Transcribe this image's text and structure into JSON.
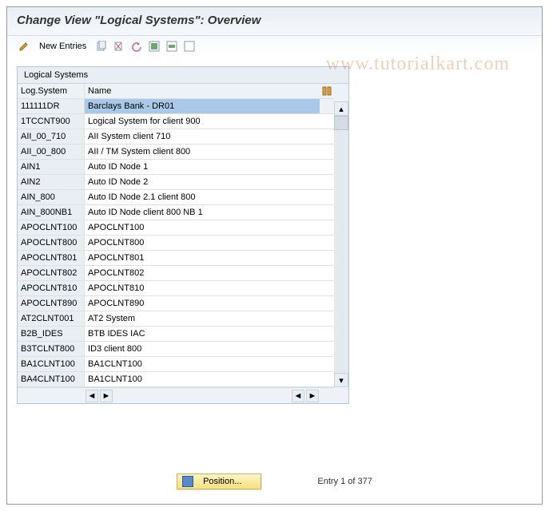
{
  "title": "Change View \"Logical Systems\": Overview",
  "toolbar": {
    "new_entries_label": "New Entries"
  },
  "panel": {
    "title": "Logical Systems",
    "columns": {
      "sys": "Log.System",
      "name": "Name"
    },
    "rows": [
      {
        "sys": "111111DR",
        "name": "Barclays Bank - DR01",
        "selected": true
      },
      {
        "sys": "1TCCNT900",
        "name": "Logical System for client 900"
      },
      {
        "sys": "AII_00_710",
        "name": "AII System client 710"
      },
      {
        "sys": "AII_00_800",
        "name": "AII / TM System client 800"
      },
      {
        "sys": "AIN1",
        "name": "Auto ID Node 1"
      },
      {
        "sys": "AIN2",
        "name": "Auto ID Node 2"
      },
      {
        "sys": "AIN_800",
        "name": "Auto ID Node 2.1 client 800"
      },
      {
        "sys": "AIN_800NB1",
        "name": "Auto ID Node client 800 NB 1"
      },
      {
        "sys": "APOCLNT100",
        "name": "APOCLNT100"
      },
      {
        "sys": "APOCLNT800",
        "name": "APOCLNT800"
      },
      {
        "sys": "APOCLNT801",
        "name": "APOCLNT801"
      },
      {
        "sys": "APOCLNT802",
        "name": "APOCLNT802"
      },
      {
        "sys": "APOCLNT810",
        "name": "APOCLNT810"
      },
      {
        "sys": "APOCLNT890",
        "name": "APOCLNT890"
      },
      {
        "sys": "AT2CLNT001",
        "name": "AT2 System"
      },
      {
        "sys": "B2B_IDES",
        "name": "BTB IDES IAC"
      },
      {
        "sys": "B3TCLNT800",
        "name": "ID3 client  800"
      },
      {
        "sys": "BA1CLNT100",
        "name": "BA1CLNT100"
      },
      {
        "sys": "BA4CLNT100",
        "name": "BA1CLNT100"
      }
    ]
  },
  "footer": {
    "position_label": "Position...",
    "entry_status": "Entry 1 of 377"
  },
  "watermark": "www.tutorialkart.com"
}
